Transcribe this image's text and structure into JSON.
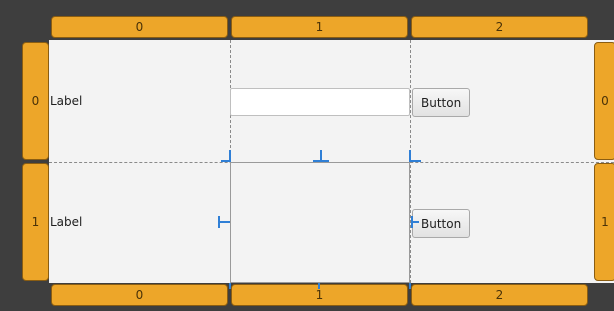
{
  "column_headers": [
    "0",
    "1",
    "2"
  ],
  "row_headers": [
    "0",
    "1"
  ],
  "cells": {
    "r0_label": "Label",
    "r1_label": "Label",
    "r0_input": {
      "value": "",
      "placeholder": ""
    },
    "r0_button": "Button",
    "r1_button": "Button"
  },
  "colors": {
    "header_fill": "#eda629",
    "grid_background": "#f3f3f3",
    "outer_background": "#3e3e3e",
    "guide_tick": "#2f7fd6"
  }
}
